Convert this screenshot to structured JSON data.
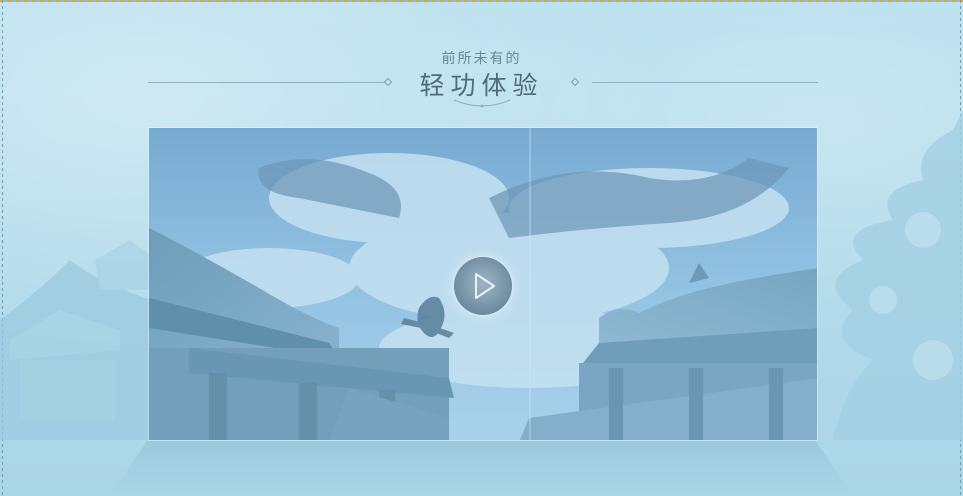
{
  "header": {
    "subtitle": "前所未有的",
    "title": "轻功体验"
  },
  "video": {
    "play_icon": "play-icon"
  },
  "colors": {
    "background": "#b3dcec",
    "title": "#4f6a79",
    "subtitle": "#6c8796",
    "rule": "#8fb0bf"
  }
}
